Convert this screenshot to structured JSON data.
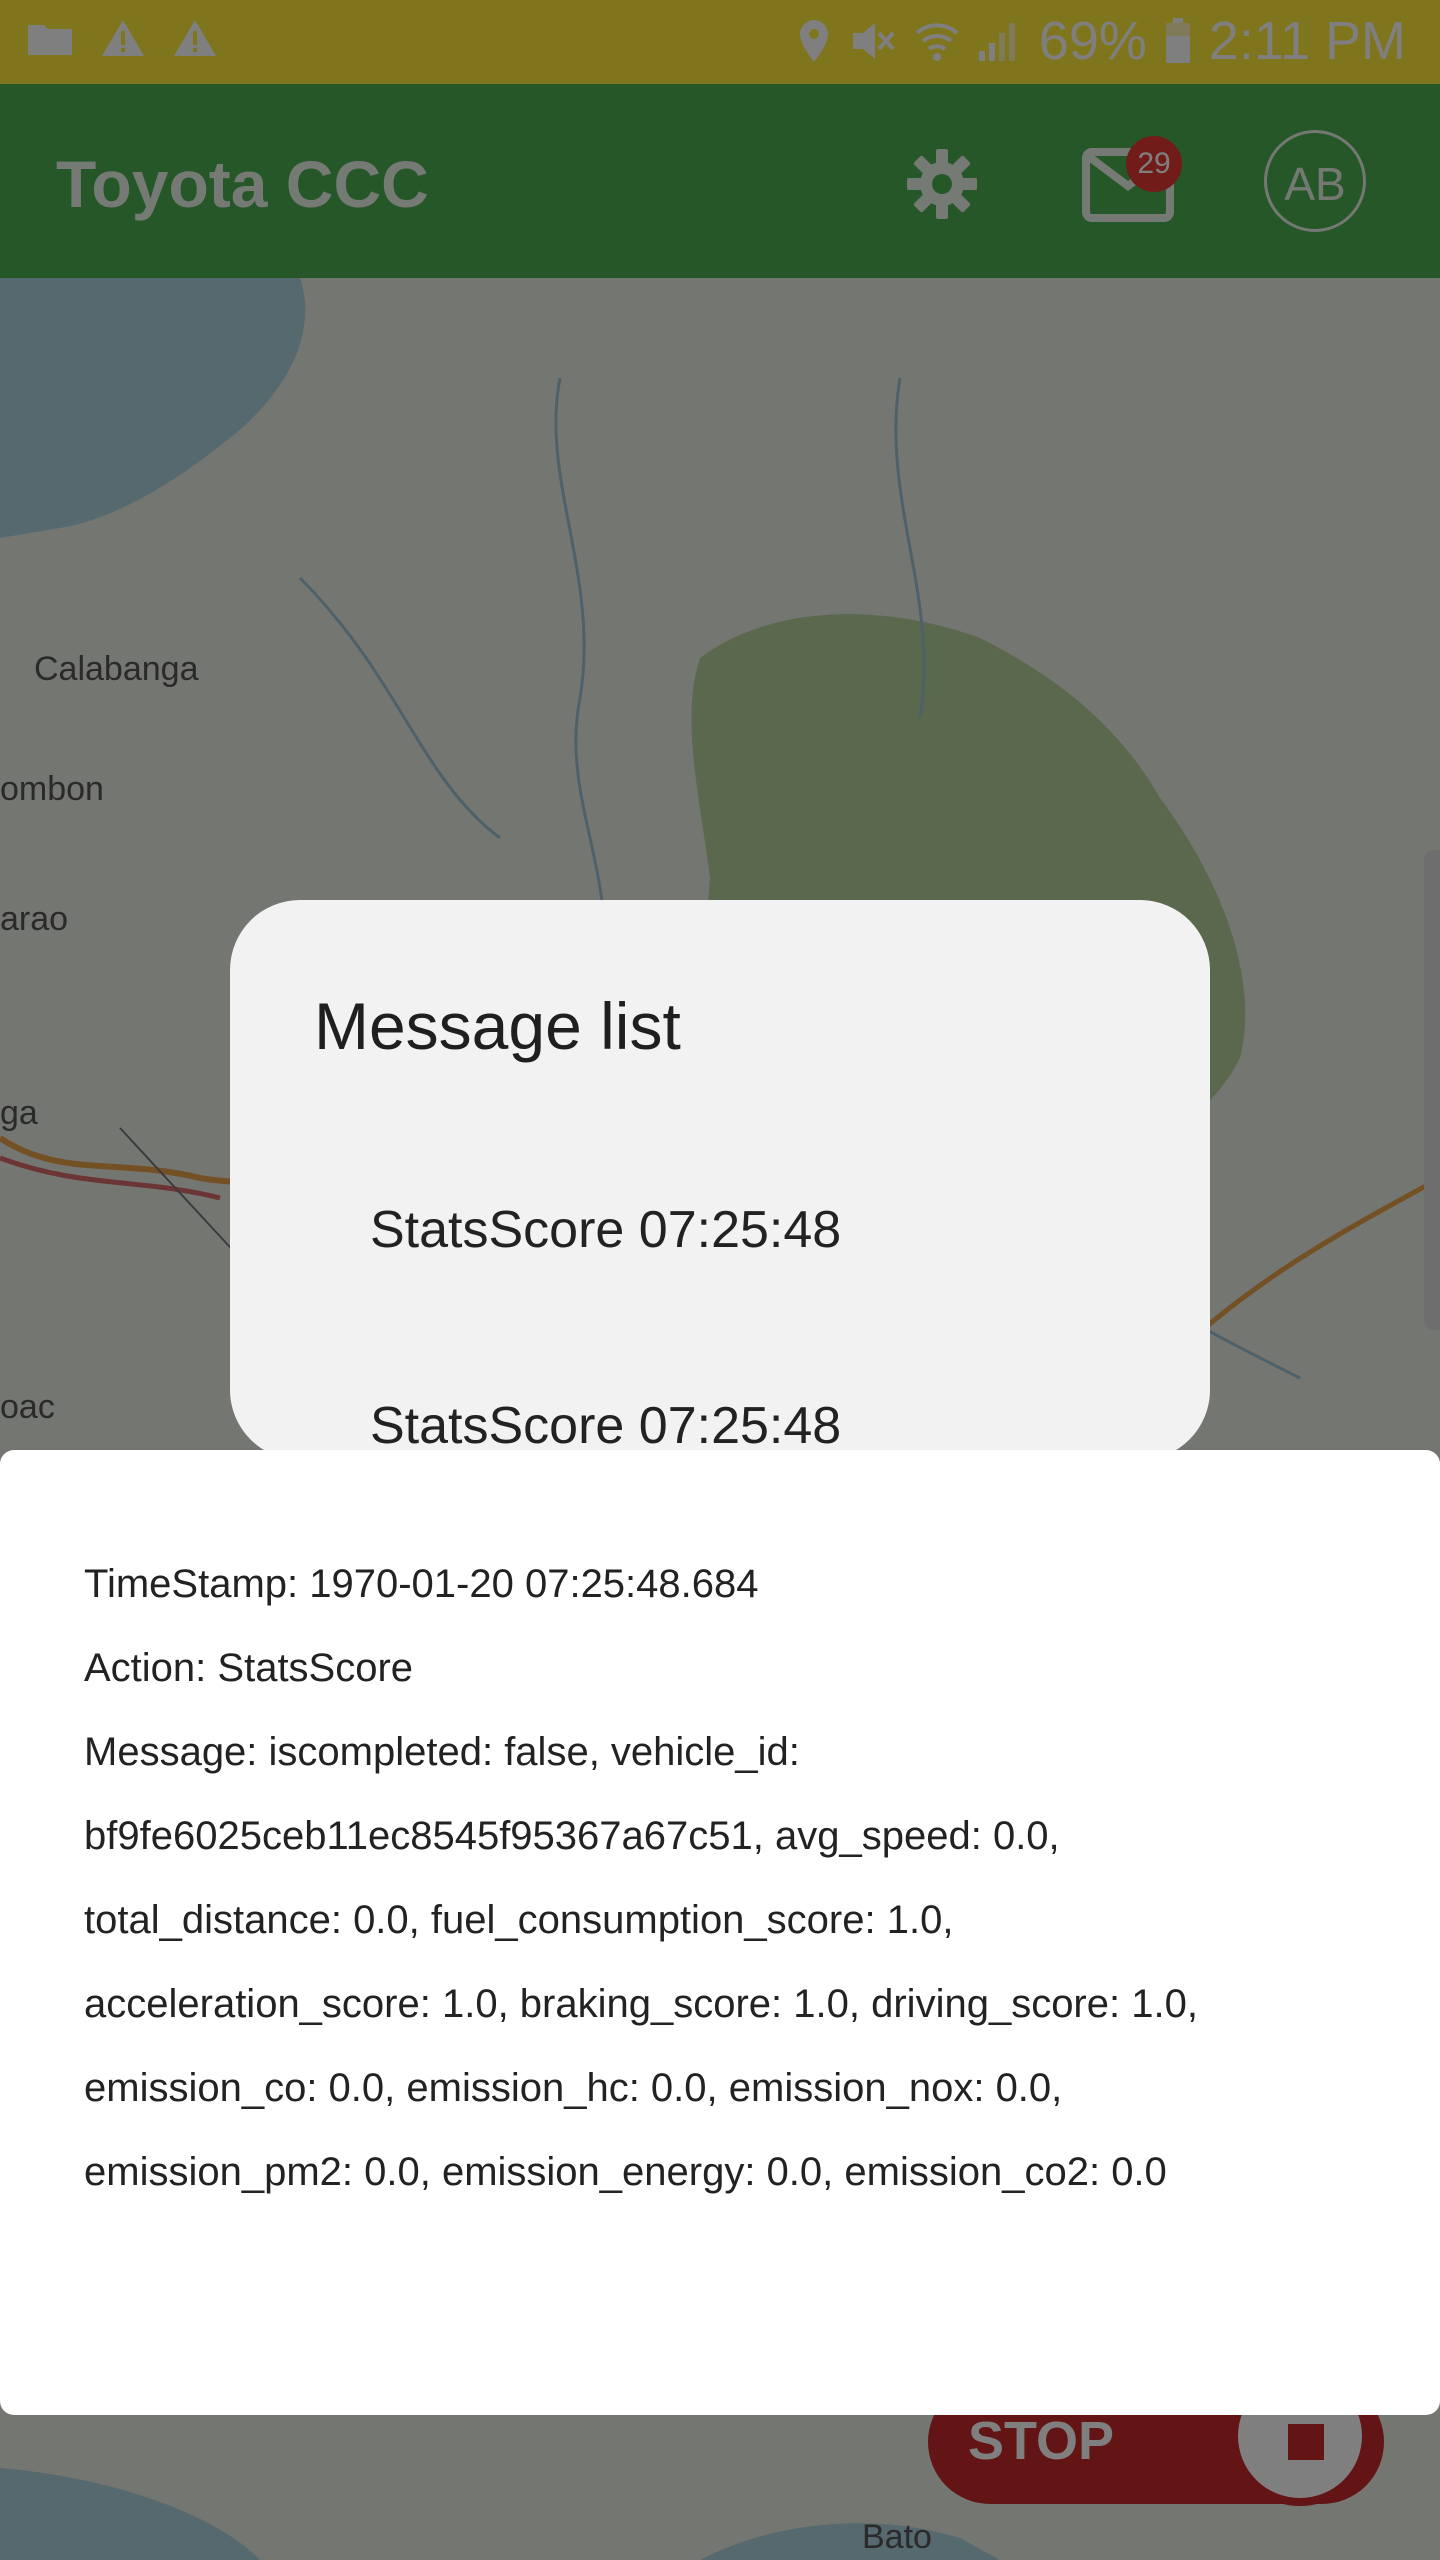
{
  "status_bar": {
    "battery": "69%",
    "time": "2:11 PM"
  },
  "app_bar": {
    "title": "Toyota CCC",
    "mail_badge": "29",
    "avatar_initials": "AB"
  },
  "map": {
    "labels": [
      "Calabanga",
      "ombon",
      "arao",
      "ga",
      "oac",
      "Bato"
    ]
  },
  "dialog": {
    "title": "Message list",
    "items": [
      "StatsScore 07:25:48",
      "StatsScore 07:25:48"
    ]
  },
  "stop_button": {
    "label": "STOP"
  },
  "sheet": {
    "lines": [
      "TimeStamp: 1970-01-20 07:25:48.684",
      "Action: StatsScore",
      "Message: iscompleted: false, vehicle_id:",
      "bf9fe6025ceb11ec8545f95367a67c51, avg_speed: 0.0,",
      "total_distance: 0.0, fuel_consumption_score: 1.0,",
      "acceleration_score: 1.0, braking_score: 1.0, driving_score: 1.0,",
      "emission_co: 0.0, emission_hc: 0.0, emission_nox: 0.0,",
      "emission_pm2: 0.0, emission_energy: 0.0, emission_co2: 0.0"
    ]
  },
  "colors": {
    "status_bar": "#ffeb3b",
    "app_bar": "#4caf50",
    "stop": "#c62828"
  }
}
